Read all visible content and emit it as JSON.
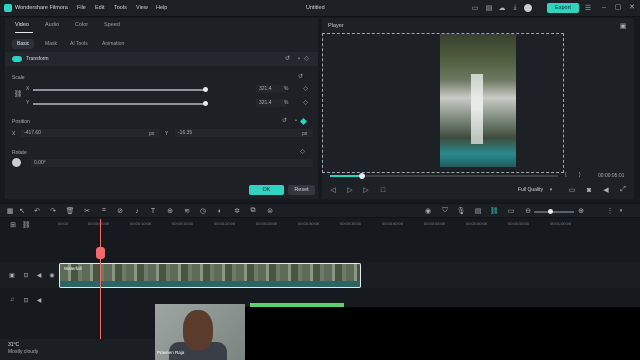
{
  "app": {
    "name": "Wondershare Filmora",
    "document_title": "Untitled",
    "menu": [
      "File",
      "Edit",
      "Tools",
      "View",
      "Help"
    ],
    "export_label": "Export",
    "accent_color": "#2fd3c0"
  },
  "panel": {
    "tabs": [
      "Video",
      "Audio",
      "Color",
      "Speed"
    ],
    "subtabs": [
      "Basic",
      "Mask",
      "AI Tools",
      "Animation"
    ],
    "transform_label": "Transform",
    "scale": {
      "label": "Scale",
      "x_label": "X",
      "y_label": "Y",
      "x_value": "321.4",
      "y_value": "321.4",
      "unit": "%"
    },
    "position": {
      "label": "Position",
      "x_label": "X",
      "y_label": "Y",
      "x_value": "-417.60",
      "y_value": "-16.35",
      "unit": "px"
    },
    "rotate": {
      "label": "Rotate",
      "value": "0.00°"
    },
    "ok_label": "OK",
    "reset_label": "Reset"
  },
  "player": {
    "title": "Player",
    "timecode": "00:00:05:01",
    "quality": "Full Quality",
    "progress": 0.14
  },
  "timeline": {
    "ticks": [
      "00:00",
      "00:00:05:00",
      "00:00:10:00",
      "00:00:15:00",
      "00:00:20:00",
      "00:00:25:00",
      "00:00:30:00",
      "00:00:35:00",
      "00:00:40:00",
      "00:00:45:00",
      "00:00:50:00",
      "00:00:55:00",
      "00:01:00:00"
    ],
    "clip_label": "Waterfall"
  },
  "webcam": {
    "name": "Praveen Raja"
  },
  "weather": {
    "temp": "31°C",
    "condition": "Mostly cloudy"
  }
}
